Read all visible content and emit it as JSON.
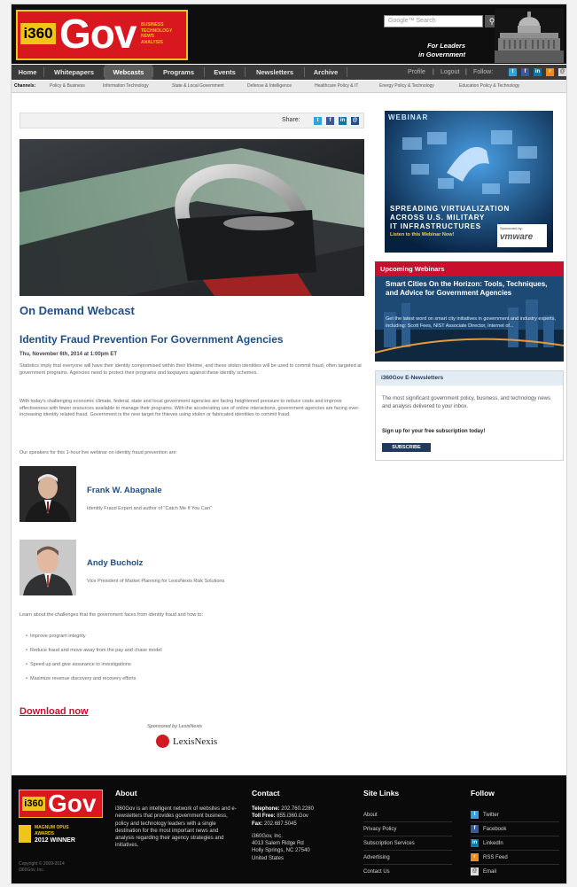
{
  "header": {
    "logo_num": "i360",
    "logo_word": "Gov",
    "logo_tagline": [
      "BUSINESS",
      "TECHNOLOGY",
      "NEWS",
      "ANALYSIS"
    ],
    "search_placeholder": "Google™ Search",
    "slogan_line1": "For Leaders",
    "slogan_line2": "in Government"
  },
  "nav": {
    "items": [
      "Home",
      "Whitepapers",
      "Webcasts",
      "Programs",
      "Events",
      "Newsletters",
      "Archive"
    ],
    "active": "Webcasts",
    "profile": "Profile",
    "logout": "Logout",
    "follow": "Follow:"
  },
  "channels": {
    "label": "Channels:",
    "items": [
      "Policy & Business",
      "Information Technology",
      "State & Local Government",
      "Defense & Intelligence",
      "Healthcare Policy & IT",
      "Energy Policy & Technology",
      "Education Policy & Technology"
    ]
  },
  "share": {
    "label": "Share:"
  },
  "article": {
    "section": "On Demand Webcast",
    "title": "Identity Fraud Prevention For Government Agencies",
    "date": "Thu, November 6th, 2014 at 1:00pm ET",
    "intro1": "Statistics imply that everyone will have their identity compromised within their lifetime, and these stolen identities will be used to commit fraud, often targeted at government programs. Agencies need to protect their programs and taxpayers against these identity schemes.",
    "intro2": "With today's challenging economic climate, federal, state and local government agencies are facing heightened pressure to reduce costs and improve effectiveness with fewer resources available to manage their programs. With the accelerating use of online interactions, government agencies are facing ever-increasing identity related fraud. Government is the new target for thieves using stolen or fabricated identities to commit fraud.",
    "speakers_intro": "Our speakers for this 1-hour live webinar on identity fraud prevention are:",
    "speakers": [
      {
        "name": "Frank W. Abagnale",
        "role": "Identity Fraud Expert and author of \"Catch Me If You Can\""
      },
      {
        "name": "Andy Bucholz",
        "role": "Vice President of Market Planning for LexisNexis Risk Solutions"
      }
    ],
    "learn_intro": "Learn about the challenges that the government faces from identity fraud and how to:",
    "bullets": [
      "Improve program integrity",
      "Reduce fraud and move away from the pay and chase model",
      "Speed up and give assurance to investigations",
      "Maximize revenue discovery and recovery efforts"
    ],
    "download": "Download now",
    "sponsored": "Sponsored by LexisNexis",
    "sponsor_logo": "LexisNexis"
  },
  "ad": {
    "label": "WEBINAR",
    "line1": "SPREADING VIRTUALIZATION",
    "line2": "ACROSS U.S. MILITARY",
    "line3": "IT INFRASTRUCTURES",
    "listen": "Listen to this Webinar Now!",
    "sponsored": "Sponsored by:",
    "sponsor": "vmware"
  },
  "upcoming": {
    "heading": "Upcoming Webinars",
    "title": "Smart Cities On the Horizon: Tools, Techniques, and Advice for Government Agencies",
    "desc": "Get the latest word on smart city initiatives in government and industry experts, including: Scott Fees, NIST Associate Director, Internet of..."
  },
  "newsletter": {
    "heading": "i360Gov E-Newsletters",
    "desc": "The most significant government policy, business, and technology news and analysis delivered to your inbox.",
    "signup": "Sign up for your free subscription today!",
    "button": "SUBSCRIBE"
  },
  "footer": {
    "logo_num": "i360",
    "logo_word": "Gov",
    "award1": "MAGNUM OPUS",
    "award2": "AWARDS",
    "award3": "2012 WINNER",
    "copyright1": "Copyright © 2009-2014",
    "copyright2": "i360Gov, Inc.",
    "about_h": "About",
    "about_text": "i360Gov is an intelligent network of websites and e-newsletters that provides government business, policy and technology leaders with a single destination for the most important news and analysis regarding their agency strategies and initiatives.",
    "contact_h": "Contact",
    "telephone_l": "Telephone:",
    "telephone": "202.760.2280",
    "tollfree_l": "Toll Free:",
    "tollfree": "855.i360.Gov",
    "fax_l": "Fax:",
    "fax": "202.687.5045",
    "addr1": "i360Gov, Inc.",
    "addr2": "4013 Salem Ridge Rd",
    "addr3": "Holly Springs, NC 27540",
    "addr4": "United States",
    "sitelinks_h": "Site Links",
    "sitelinks": [
      "About",
      "Privacy Policy",
      "Subscription Services",
      "Advertising",
      "Contact Us"
    ],
    "follow_h": "Follow",
    "follow": [
      "Twitter",
      "Facebook",
      "LinkedIn",
      "RSS Feed",
      "Email"
    ]
  },
  "colors": {
    "brand_red": "#d9171f",
    "brand_gold": "#f0c419",
    "link_blue": "#1e4e8c",
    "download_red": "#c8102e"
  }
}
